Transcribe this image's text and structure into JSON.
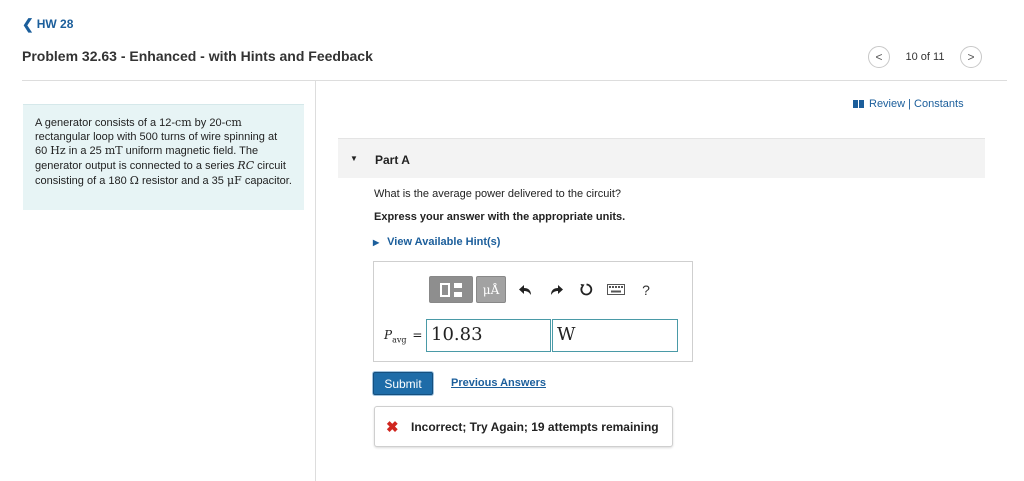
{
  "nav": {
    "back_label": "HW 28",
    "back_glyph": "❮"
  },
  "header": {
    "title": "Problem 32.63 - Enhanced - with Hints and Feedback",
    "pager_text": "10 of 11",
    "prev_glyph": "<",
    "next_glyph": ">"
  },
  "problem": {
    "t1": "A generator consists of a 12-",
    "u1": "cm",
    "t2": " by 20-",
    "u2": "cm",
    "t3": " rectangular loop with 500 turns of wire spinning at 60 ",
    "u3": "Hz",
    "t4": " in a 25 ",
    "u4": "mT",
    "t5": " uniform magnetic field. The generator output is connected to a series ",
    "u5": "RC",
    "t6": " circuit consisting of a 180 ",
    "u6": "Ω",
    "t7": " resistor and a 35 ",
    "u7": "μF",
    "t8": " capacitor."
  },
  "resources": {
    "label": "Review | Constants"
  },
  "part": {
    "label": "Part A",
    "caret_glyph": "▼",
    "question": "What is the average power delivered to the circuit?",
    "instruction": "Express your answer with the appropriate units.",
    "hints_label": "View Available Hint(s)",
    "hints_glyph": "▶"
  },
  "toolbar": {
    "unit_label": "μÅ",
    "help_label": "?"
  },
  "answer": {
    "variable": "P",
    "subscript": "avg",
    "equals": "=",
    "value": "10.83",
    "unit": "W"
  },
  "actions": {
    "submit_label": "Submit",
    "previous_answers_label": "Previous Answers"
  },
  "feedback": {
    "icon_glyph": "✖",
    "text": "Incorrect; Try Again; 19 attempts remaining"
  },
  "colors": {
    "link_blue": "#1b5e9b",
    "submit_blue": "#1e6ca8",
    "problem_bg": "#e7f4f5",
    "error_red": "#d0261f",
    "field_border": "#4a9aa7"
  },
  "icons": {
    "template": "template-icon",
    "units": "units-icon",
    "undo": "undo-icon",
    "redo": "redo-icon",
    "reset": "reset-icon",
    "keyboard": "keyboard-icon",
    "help": "help-icon",
    "review": "book-icon",
    "incorrect": "x-icon"
  }
}
